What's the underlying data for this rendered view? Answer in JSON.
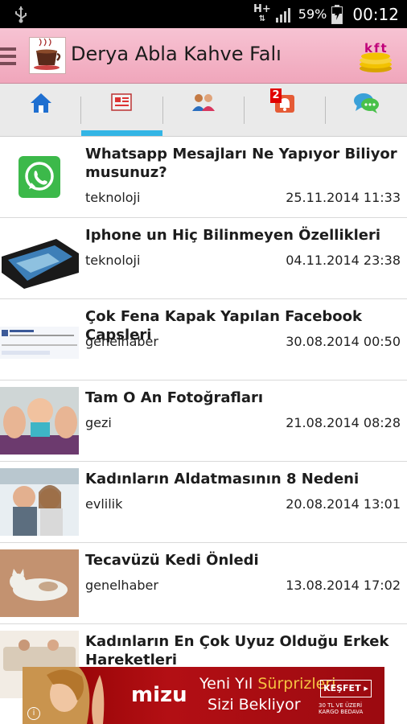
{
  "status_bar": {
    "network_type": "H+",
    "battery_percent": "59%",
    "time": "00:12"
  },
  "app_bar": {
    "title": "Derya Abla Kahve Falı",
    "coins_label": "kft"
  },
  "tabs": [
    {
      "name": "home",
      "icon": "home-icon",
      "selected": false
    },
    {
      "name": "news",
      "icon": "newspaper-icon",
      "selected": true
    },
    {
      "name": "users",
      "icon": "users-icon",
      "selected": false
    },
    {
      "name": "notifications",
      "icon": "bell-icon",
      "badge": "2",
      "selected": false
    },
    {
      "name": "chat",
      "icon": "chat-icon",
      "selected": false
    }
  ],
  "articles": [
    {
      "title": "Whatsapp Mesajları Ne Yapıyor Biliyor musunuz?",
      "category": "teknoloji",
      "date": "25.11.2014 11:33",
      "thumb": "whatsapp-logo"
    },
    {
      "title": "Iphone un Hiç Bilinmeyen Özellikleri",
      "category": "teknoloji",
      "date": "04.11.2014 23:38",
      "thumb": "iphone-photo"
    },
    {
      "title": "Çok Fena Kapak Yapılan Facebook Capsleri",
      "category": "genelhaber",
      "date": "30.08.2014 00:50",
      "thumb": "facebook-screenshot"
    },
    {
      "title": "Tam O An Fotoğrafları",
      "category": "gezi",
      "date": "21.08.2014 08:28",
      "thumb": "baby-photo"
    },
    {
      "title": "Kadınların Aldatmasının 8 Nedeni",
      "category": "evlilik",
      "date": "20.08.2014 13:01",
      "thumb": "couple-photo"
    },
    {
      "title": "Tecavüzü Kedi Önledi",
      "category": "genelhaber",
      "date": "13.08.2014 17:02",
      "thumb": "cat-photo"
    },
    {
      "title": "Kadınların En Çok Uyuz Olduğu Erkek Hareketleri",
      "category": "",
      "date": "",
      "thumb": "sofa-photo"
    }
  ],
  "ad": {
    "brand": "mizu",
    "headline_part1": "Yeni Yıl ",
    "headline_highlight": "Sürprizleri",
    "headline_line2": "Sizi Bekliyor",
    "button": "KEŞFET ▸",
    "shipping_line1": "30 TL VE ÜZERİ",
    "shipping_line2": "KARGO BEDAVA",
    "info": "i"
  },
  "colors": {
    "app_bar": "#f0a6bb",
    "tab_indicator": "#33b5e5",
    "ad_background": "#b30f14"
  }
}
